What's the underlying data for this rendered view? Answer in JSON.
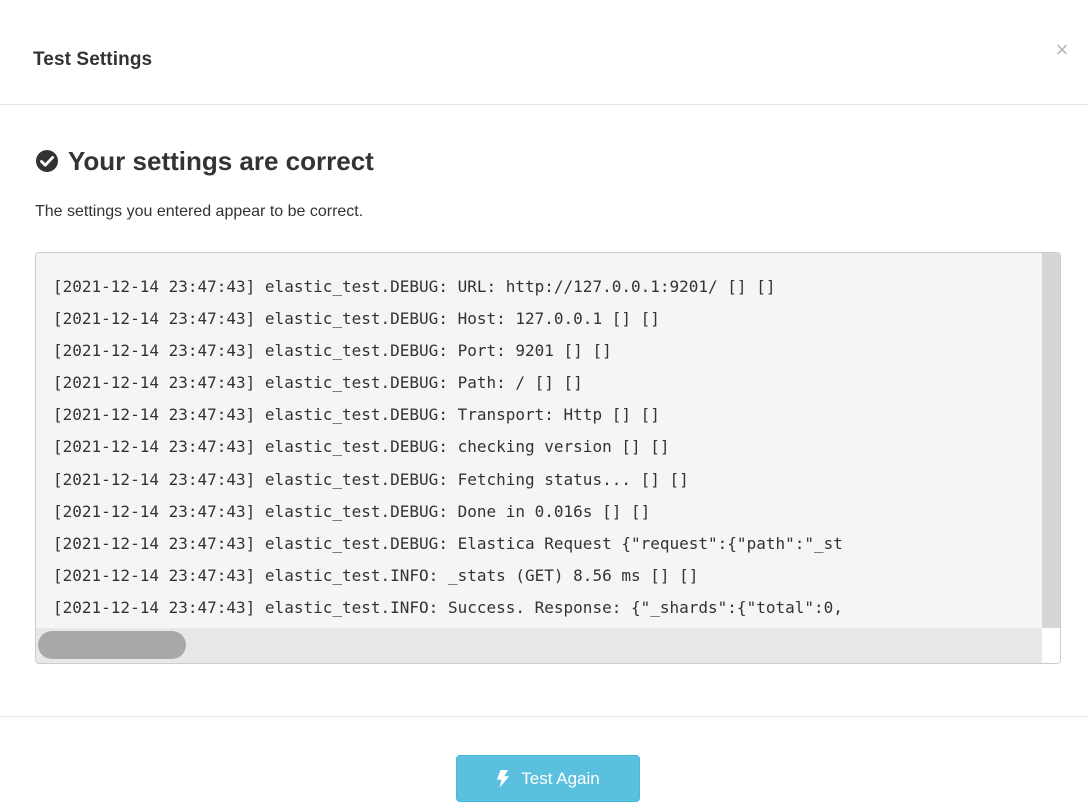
{
  "dialog": {
    "title": "Test Settings",
    "close_glyph": "×"
  },
  "status": {
    "icon": "check-circle-icon",
    "heading": "Your settings are correct",
    "description": "The settings you entered appear to be correct."
  },
  "log": {
    "lines": [
      "[2021-12-14 23:47:43] elastic_test.DEBUG: URL: http://127.0.0.1:9201/ [] []",
      "[2021-12-14 23:47:43] elastic_test.DEBUG: Host: 127.0.0.1 [] []",
      "[2021-12-14 23:47:43] elastic_test.DEBUG: Port: 9201 [] []",
      "[2021-12-14 23:47:43] elastic_test.DEBUG: Path: / [] []",
      "[2021-12-14 23:47:43] elastic_test.DEBUG: Transport: Http [] []",
      "[2021-12-14 23:47:43] elastic_test.DEBUG: checking version [] []",
      "[2021-12-14 23:47:43] elastic_test.DEBUG: Fetching status... [] []",
      "[2021-12-14 23:47:43] elastic_test.DEBUG: Done in 0.016s [] []",
      "[2021-12-14 23:47:43] elastic_test.DEBUG: Elastica Request {\"request\":{\"path\":\"_st",
      "[2021-12-14 23:47:43] elastic_test.INFO: _stats (GET) 8.56 ms [] []",
      "[2021-12-14 23:47:43] elastic_test.INFO: Success. Response: {\"_shards\":{\"total\":0,"
    ]
  },
  "footer": {
    "button_icon": "bolt-icon",
    "button_label": "Test Again",
    "button_color": "#5bc0de"
  }
}
